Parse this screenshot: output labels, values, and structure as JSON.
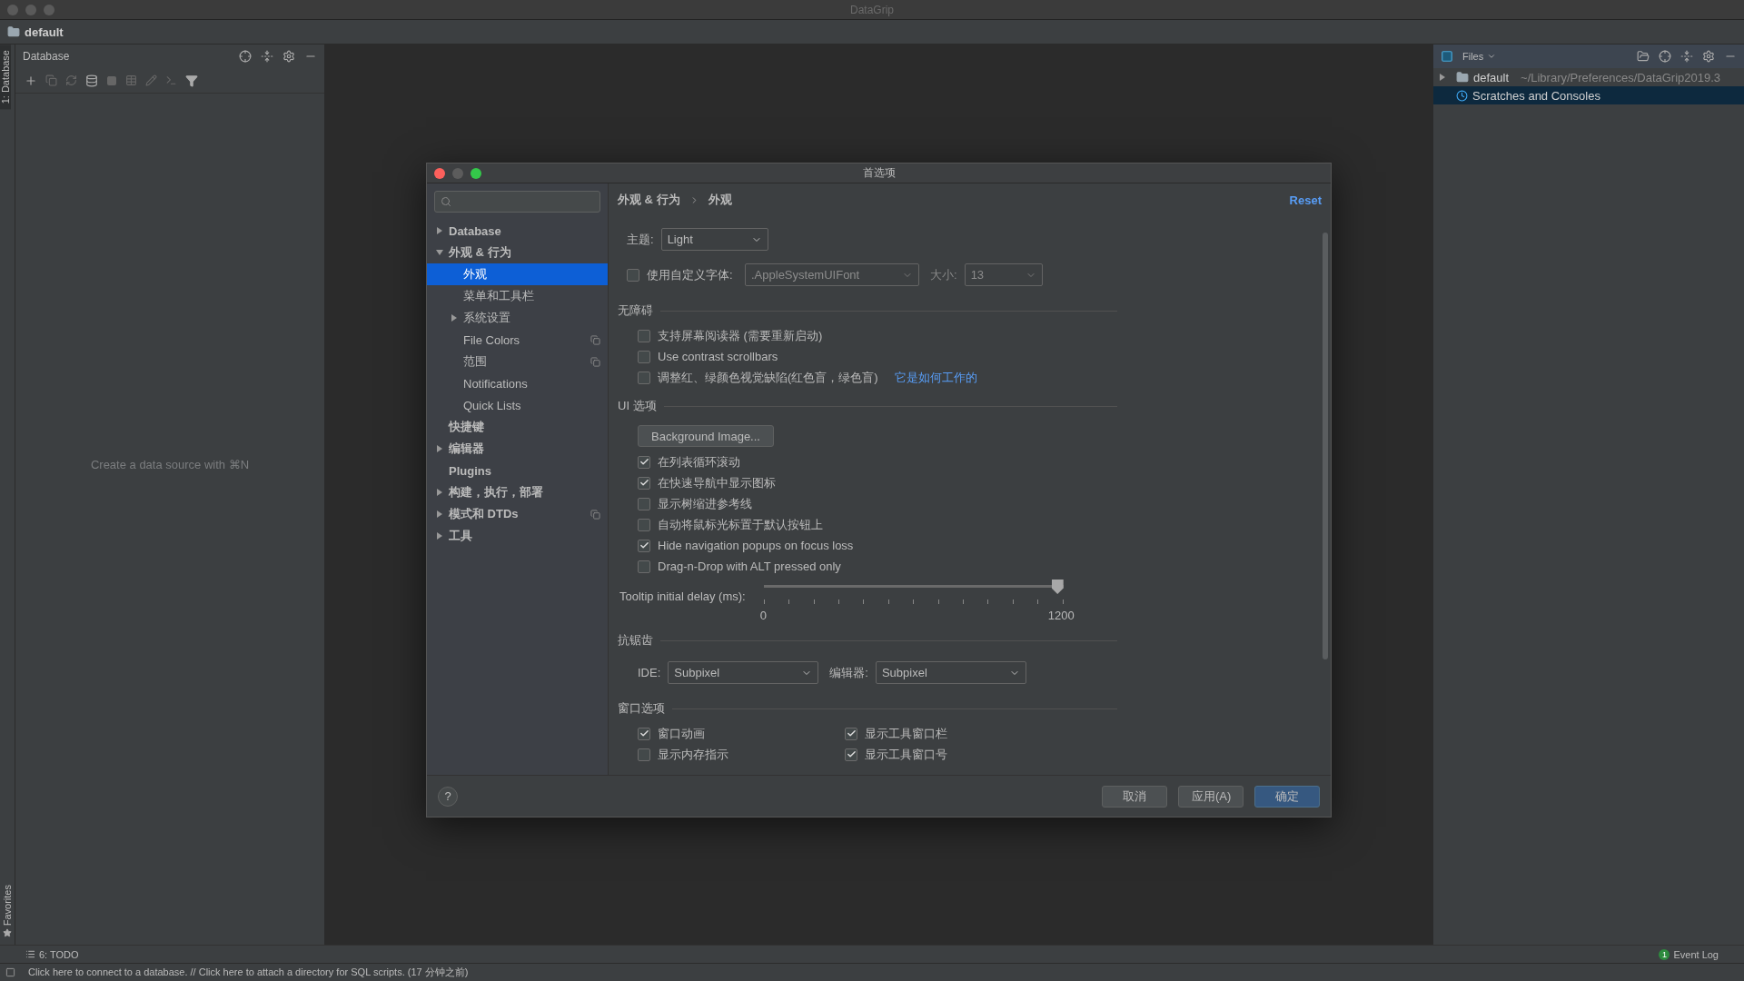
{
  "window": {
    "title": "DataGrip"
  },
  "project": {
    "name": "default"
  },
  "left_strip": {
    "tabs": [
      {
        "label": "1: Database",
        "selected": true
      }
    ],
    "favorites": "Favorites"
  },
  "database_panel": {
    "title": "Database",
    "empty_text": "Create a data source with ⌘N"
  },
  "files_panel": {
    "title": "Files",
    "tree": [
      {
        "label": "default",
        "path": "~/Library/Preferences/DataGrip2019.3",
        "expanded": false,
        "selected": false
      },
      {
        "label": "Scratches and Consoles",
        "selected": true
      }
    ]
  },
  "dialog": {
    "title": "首选项",
    "help": "?",
    "tree": [
      {
        "label": "Database",
        "expanded": false,
        "selected": false
      },
      {
        "label": "外观 & 行为",
        "expanded": true,
        "selected": false,
        "children": [
          {
            "label": "外观",
            "selected": true
          },
          {
            "label": "菜单和工具栏",
            "selected": false
          },
          {
            "label": "系统设置",
            "expanded": false,
            "selected": false
          },
          {
            "label": "File Colors",
            "selected": false,
            "shared": true
          },
          {
            "label": "范围",
            "selected": false,
            "shared": true
          },
          {
            "label": "Notifications",
            "selected": false
          },
          {
            "label": "Quick Lists",
            "selected": false
          }
        ]
      },
      {
        "label": "快捷键",
        "selected": false
      },
      {
        "label": "编辑器",
        "expanded": false,
        "selected": false
      },
      {
        "label": "Plugins",
        "selected": false
      },
      {
        "label": "构建，执行，部署",
        "expanded": false,
        "selected": false
      },
      {
        "label": "模式和 DTDs",
        "expanded": false,
        "selected": false,
        "shared": true
      },
      {
        "label": "工具",
        "expanded": false,
        "selected": false
      }
    ],
    "breadcrumb": [
      "外观 & 行为",
      "外观"
    ],
    "reset": "Reset",
    "theme": {
      "label": "主题:",
      "value": "Light"
    },
    "custom_font": {
      "label": "使用自定义字体:",
      "checked": false,
      "value": ".AppleSystemUIFont",
      "size_label": "大小:",
      "size": "13"
    },
    "sections": [
      {
        "title": "无障碍",
        "items": [
          {
            "kind": "checkbox",
            "label": "支持屏幕阅读器 (需要重新启动)",
            "checked": false
          },
          {
            "kind": "checkbox",
            "label": "Use contrast scrollbars",
            "checked": false
          },
          {
            "kind": "checkbox",
            "label": "调整红、绿颜色视觉缺陷(红色盲，绿色盲)",
            "checked": false,
            "link": "它是如何工作的"
          }
        ]
      },
      {
        "title": "UI 选项",
        "items": [
          {
            "kind": "button",
            "label": "Background Image..."
          },
          {
            "kind": "checkbox",
            "label": "在列表循环滚动",
            "checked": true
          },
          {
            "kind": "checkbox",
            "label": "在快速导航中显示图标",
            "checked": true
          },
          {
            "kind": "checkbox",
            "label": "显示树缩进参考线",
            "checked": false
          },
          {
            "kind": "checkbox",
            "label": "自动将鼠标光标置于默认按钮上",
            "checked": false
          },
          {
            "kind": "checkbox",
            "label": "Hide navigation popups on focus loss",
            "checked": true
          },
          {
            "kind": "checkbox",
            "label": "Drag-n-Drop with ALT pressed only",
            "checked": false
          },
          {
            "kind": "slider",
            "label": "Tooltip initial delay (ms):",
            "level": 1,
            "min": "0",
            "max": "1200"
          }
        ]
      },
      {
        "title": "抗锯齿",
        "items": [
          {
            "kind": "selects",
            "fields": [
              {
                "label": "IDE:",
                "value": "Subpixel"
              },
              {
                "label": "编辑器:",
                "value": "Subpixel"
              }
            ]
          }
        ]
      },
      {
        "title": "窗口选项",
        "items": [
          {
            "kind": "grid",
            "options": [
              {
                "label": "窗口动画",
                "checked": true
              },
              {
                "label": "显示工具窗口栏",
                "checked": true
              },
              {
                "label": "显示内存指示",
                "checked": false
              },
              {
                "label": "显示工具窗口号",
                "checked": true
              }
            ]
          }
        ]
      }
    ],
    "buttons": [
      {
        "label": "取消",
        "primary": false
      },
      {
        "label": "应用(A)",
        "primary": false
      },
      {
        "label": "确定",
        "primary": true
      }
    ]
  },
  "bottom_bar": {
    "todo": "6: TODO",
    "event_log": {
      "badge": "1",
      "label": "Event Log"
    }
  },
  "status_bar": {
    "text": "Click here to connect to a database. // Click here to attach a directory for SQL scripts. (17 分钟之前)"
  }
}
